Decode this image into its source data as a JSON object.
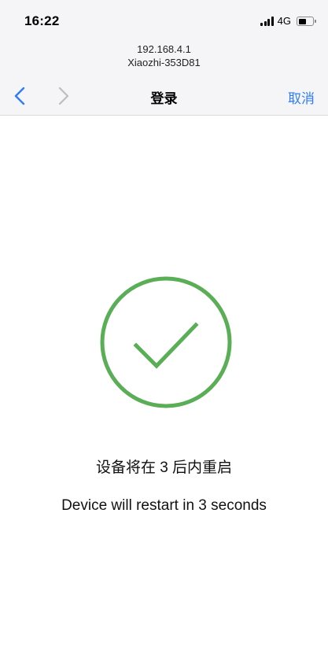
{
  "status_bar": {
    "time": "16:22",
    "network": "4G",
    "signal_icon": "signal-bars-icon",
    "battery_icon": "battery-icon"
  },
  "address_bar": {
    "ip": "192.168.4.1",
    "ssid": "Xiaozhi-353D81"
  },
  "nav": {
    "title": "登录",
    "cancel_label": "取消",
    "back_icon": "chevron-left-icon",
    "forward_icon": "chevron-right-icon"
  },
  "main": {
    "status_icon": "checkmark-circle-icon",
    "message_cn": "设备将在 3 后内重启",
    "message_en": "Device will restart in 3 seconds"
  },
  "colors": {
    "accent": "#2f7cf6",
    "success": "#5aae55",
    "header_bg": "#f5f5f7"
  }
}
